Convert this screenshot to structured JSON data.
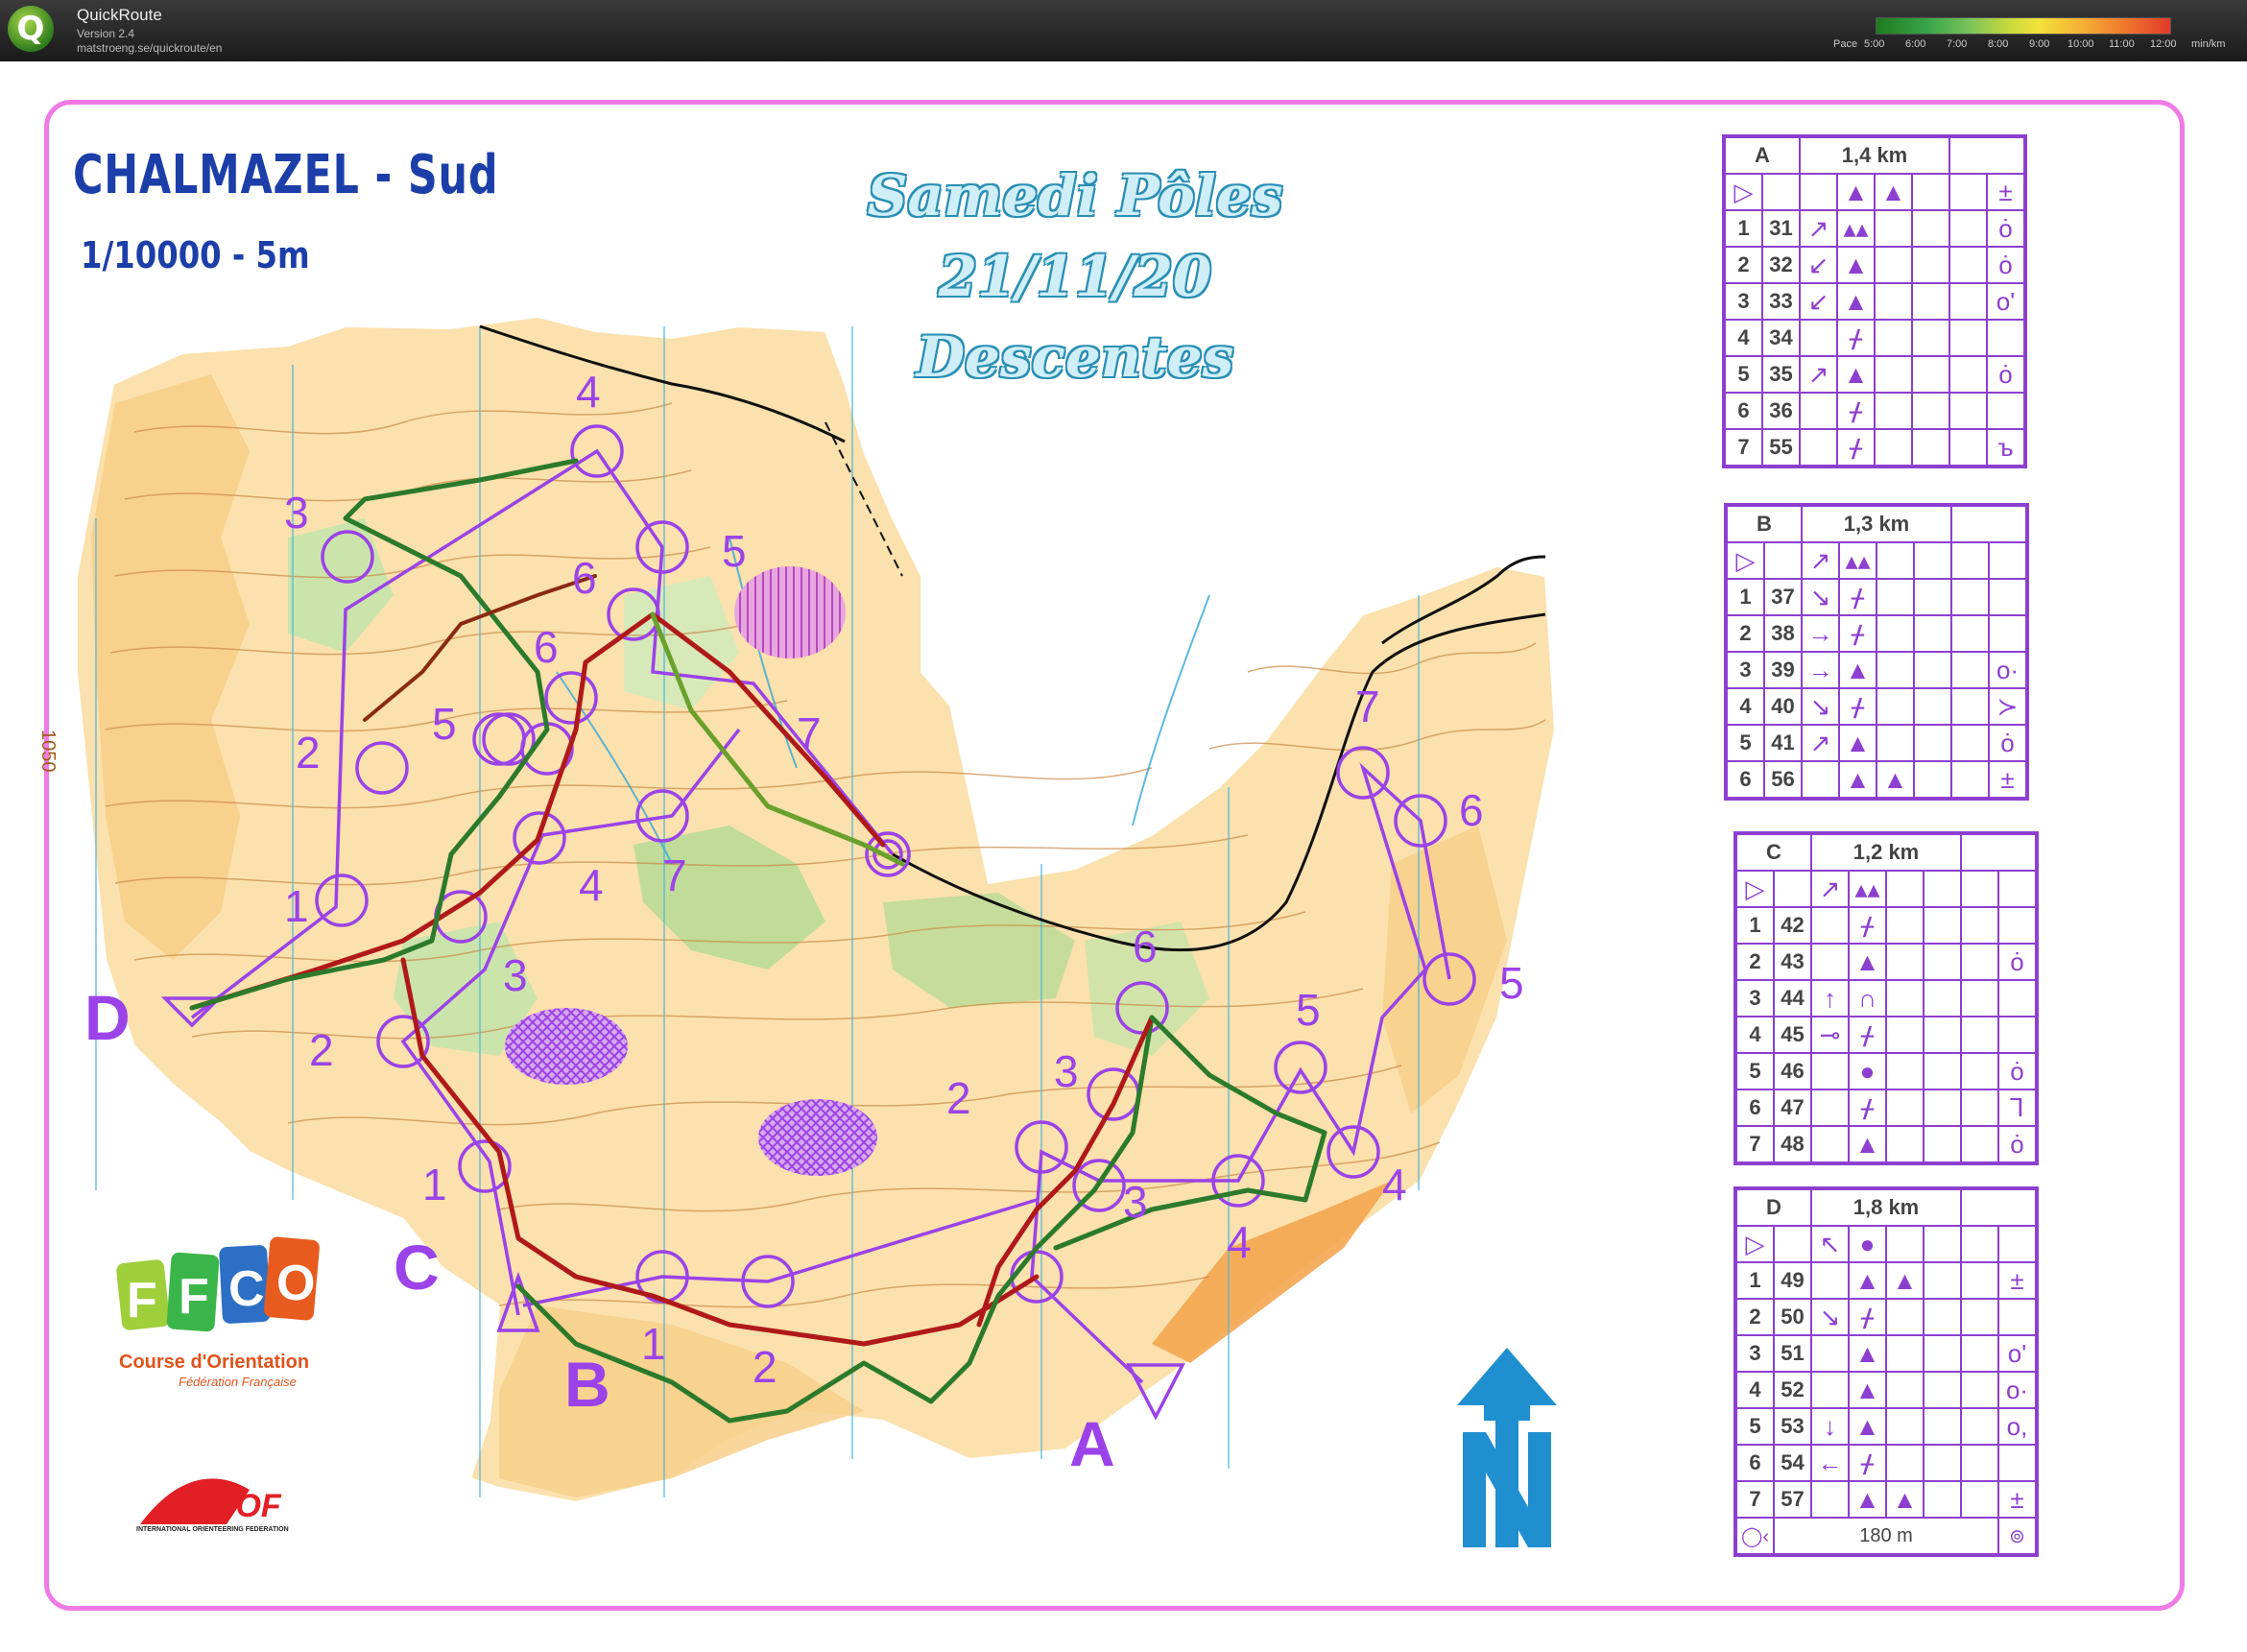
{
  "app": {
    "name": "QuickRoute",
    "version": "Version 2.4",
    "url": "matstroeng.se/quickroute/en",
    "pace_label": "Pace",
    "pace_ticks": [
      "5:00",
      "6:00",
      "7:00",
      "8:00",
      "9:00",
      "10:00",
      "11:00",
      "12:00",
      "min/km"
    ],
    "logo_letter": "Q"
  },
  "map": {
    "title": "CHALMAZEL - Sud",
    "scale": "1/10000 - 5m",
    "event_lines": [
      "Samedi Pôles",
      "21/11/20",
      "Descentes"
    ],
    "course_letters": [
      "A",
      "B",
      "C",
      "D"
    ],
    "contour_tag": "1050"
  },
  "courses": [
    {
      "name": "A",
      "length": "1,4 km",
      "start_symbols": [
        "",
        "",
        "▲",
        "▲",
        "",
        "±"
      ],
      "rows": [
        {
          "n": "1",
          "code": "31",
          "dir": "↗",
          "feat": "▴▴",
          "feat2": "",
          "detail": "ȯ"
        },
        {
          "n": "2",
          "code": "32",
          "dir": "↙",
          "feat": "▲",
          "feat2": "",
          "detail": "ȯ"
        },
        {
          "n": "3",
          "code": "33",
          "dir": "↙",
          "feat": "▲",
          "feat2": "",
          "detail": "o'"
        },
        {
          "n": "4",
          "code": "34",
          "dir": "",
          "feat": "ᚋ",
          "feat2": "",
          "detail": ""
        },
        {
          "n": "5",
          "code": "35",
          "dir": "↗",
          "feat": "▲",
          "feat2": "",
          "detail": "ȯ"
        },
        {
          "n": "6",
          "code": "36",
          "dir": "",
          "feat": "ᚋ",
          "feat2": "",
          "detail": ""
        },
        {
          "n": "7",
          "code": "55",
          "dir": "",
          "feat": "ᚋ",
          "feat2": "",
          "detail": "ъ"
        }
      ]
    },
    {
      "name": "B",
      "length": "1,3 km",
      "start_symbols": [
        "",
        "↗",
        "▴▴",
        "",
        "",
        ""
      ],
      "rows": [
        {
          "n": "1",
          "code": "37",
          "dir": "↘",
          "feat": "ᚋ",
          "feat2": "",
          "detail": ""
        },
        {
          "n": "2",
          "code": "38",
          "dir": "→",
          "feat": "ᚋ",
          "feat2": "",
          "detail": ""
        },
        {
          "n": "3",
          "code": "39",
          "dir": "→",
          "feat": "▲",
          "feat2": "",
          "detail": "o·"
        },
        {
          "n": "4",
          "code": "40",
          "dir": "↘",
          "feat": "ᚋ",
          "feat2": "",
          "detail": "≻"
        },
        {
          "n": "5",
          "code": "41",
          "dir": "↗",
          "feat": "▲",
          "feat2": "",
          "detail": "ȯ"
        },
        {
          "n": "6",
          "code": "56",
          "dir": "",
          "feat": "▲",
          "feat2": "▲",
          "detail": "±"
        }
      ]
    },
    {
      "name": "C",
      "length": "1,2 km",
      "start_symbols": [
        "",
        "↗",
        "▴▴",
        "",
        "",
        ""
      ],
      "rows": [
        {
          "n": "1",
          "code": "42",
          "dir": "",
          "feat": "ᚋ",
          "feat2": "",
          "detail": ""
        },
        {
          "n": "2",
          "code": "43",
          "dir": "",
          "feat": "▲",
          "feat2": "",
          "detail": "ȯ"
        },
        {
          "n": "3",
          "code": "44",
          "dir": "↑",
          "feat": "∩",
          "feat2": "",
          "detail": ""
        },
        {
          "n": "4",
          "code": "45",
          "dir": "⊸",
          "feat": "ᚋ",
          "feat2": "",
          "detail": ""
        },
        {
          "n": "5",
          "code": "46",
          "dir": "",
          "feat": "●",
          "feat2": "",
          "detail": "ȯ"
        },
        {
          "n": "6",
          "code": "47",
          "dir": "",
          "feat": "ᚋ",
          "feat2": "",
          "detail": "⅂"
        },
        {
          "n": "7",
          "code": "48",
          "dir": "",
          "feat": "▲",
          "feat2": "",
          "detail": "ȯ"
        }
      ]
    },
    {
      "name": "D",
      "length": "1,8 km",
      "start_symbols": [
        "",
        "↖",
        "●",
        "",
        "",
        ""
      ],
      "rows": [
        {
          "n": "1",
          "code": "49",
          "dir": "",
          "feat": "▲",
          "feat2": "▲",
          "detail": "±"
        },
        {
          "n": "2",
          "code": "50",
          "dir": "↘",
          "feat": "ᚋ",
          "feat2": "",
          "detail": ""
        },
        {
          "n": "3",
          "code": "51",
          "dir": "",
          "feat": "▲",
          "feat2": "",
          "detail": "o'"
        },
        {
          "n": "4",
          "code": "52",
          "dir": "",
          "feat": "▲",
          "feat2": "",
          "detail": "o·"
        },
        {
          "n": "5",
          "code": "53",
          "dir": "↓",
          "feat": "▲",
          "feat2": "",
          "detail": "o,"
        },
        {
          "n": "6",
          "code": "54",
          "dir": "←",
          "feat": "ᚋ",
          "feat2": "",
          "detail": ""
        },
        {
          "n": "7",
          "code": "57",
          "dir": "",
          "feat": "▲",
          "feat2": "▲",
          "detail": "±"
        }
      ],
      "finish_distance": "180 m"
    }
  ],
  "logos": {
    "ffco_letters": [
      "F",
      "F",
      "C",
      "O"
    ],
    "ffco_line1": "Course d'Orientation",
    "ffco_line2": "Fédération Française",
    "iof_text": "IOF",
    "iof_caption": "INTERNATIONAL ORIENTEERING FEDERATION"
  },
  "colors": {
    "course_purple": "#9b42e8",
    "table_purple": "#8d3fd0",
    "title_blue": "#1b3ea8",
    "open_land": "#f7cf8a",
    "forest_green": "#9ad88a",
    "route_red": "#b01919",
    "route_green": "#2c7a2c"
  }
}
